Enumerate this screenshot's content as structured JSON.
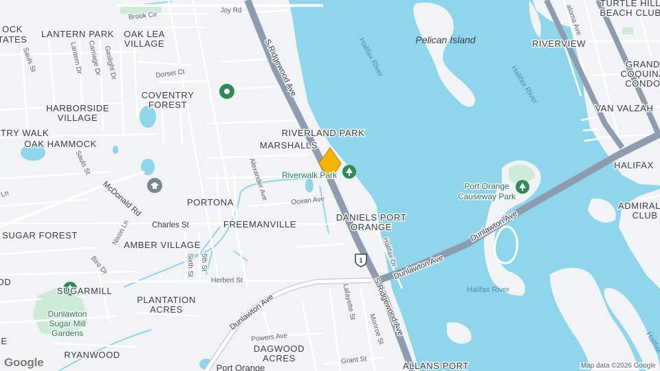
{
  "map": {
    "logo": "Google",
    "attribution": "Map data ©2026 Google",
    "colors": {
      "land": "#f1f3f4",
      "water": "#8fd6ec",
      "highway": "#8e9cb0",
      "road": "#ffffff",
      "park": "#cdebd6",
      "marker": "#f4b400"
    },
    "neighborhoods": {
      "lantern_park": "LANTERN PARK",
      "oak_lea": "OAK LEA",
      "village": "VILLAGE",
      "ock": "OCK",
      "tates": "TATES",
      "coventry": "COVENTRY",
      "forest": "FOREST",
      "harborside": "HARBORSIDE",
      "village2": "VILLAGE",
      "try_walk": "TRY WALK",
      "oak_hammock": "OAK HAMMOCK",
      "riverland_park": "RIVERLAND PARK",
      "marshalls": "MARSHALLS",
      "portona": "PORTONA",
      "freemanville": "FREEMANVILLE",
      "daniels_port": "DANIELS PORT",
      "orange": "ORANGE",
      "sugar_forest": "SUGAR FOREST",
      "amber_village": "AMBER VILLAGE",
      "od": "OD",
      "sugarmill": "SUGARMILL",
      "plantation": "PLANTATION",
      "acres": "ACRES",
      "e": "E",
      "ryanwood": "RYANWOOD",
      "dagwood": "DAGWOOD",
      "acres2": "ACRES",
      "allans_port": "ALLANS PORT",
      "riverview": "RIVERVIEW",
      "turtle_hill": "TURTLE HILL",
      "beach_club": "BEACH CLUB",
      "grand": "GRAND",
      "coquina": "COQUINA",
      "condo": "CONDO",
      "van_valzah": "VAN VALZAH",
      "halifax": "HALIFAX",
      "admiral": "ADMIRAL",
      "club": "CLUB",
      "ock2": "OCK"
    },
    "streets": {
      "joy_rd": "Joy Rd",
      "brook_cir": "Brook Cir",
      "dorset_ct": "Dorset Ct",
      "sauls_st": "Sauls St",
      "lantern_dr": "Lantern Dr",
      "carriage_dr": "Carriage Dr",
      "gaslight_dr": "Gaslight Dr",
      "sauls_st2": "Sauls St",
      "s_ridgewood_top": "S Ridgewood Ave",
      "s_ridgewood_bottom": "S Ridgewood Ave",
      "alexander_ave": "Alexander Ave",
      "ocean_ave": "Ocean Ave",
      "mcdonald_rd": "McDonald Rd",
      "charles_st": "Charles St",
      "nixon_ln": "Nixon Ln",
      "biro_dr": "Biro Dr",
      "sixth_st": "Sixth St",
      "fifth_st": "5th St",
      "herbert_st": "Herbert St",
      "dunlawton_ave_w": "Dunlawton Ave",
      "dunlawton_ave_mid": "Dunlawton Ave",
      "dunlawton_ave_e": "Dunlawton Ave",
      "halifax_dr": "Halifax Dr",
      "lafayette_st": "Lafayette St",
      "monroe_st": "Monroe St",
      "powers_ave": "Powers Ave",
      "grant_st": "Grant St",
      "paloma_ave": "aloma Ave",
      "ln": "Ln",
      "port_orange": "Port Orange",
      "route_1": "1"
    },
    "water": {
      "halifax_river_1": "Halifax River",
      "halifax_river_2": "Halifax River",
      "halifax_river_3": "Halifax River",
      "halifax_river_4": "Halifax"
    },
    "places": {
      "pelican_island": "Pelican Island",
      "riverwalk_park": "Riverwalk Park",
      "causeway_park_1": "Port Orange",
      "causeway_park_2": "Causeway Park",
      "dunlawton_1": "Dunlawton",
      "dunlawton_2": "Sugar Mill",
      "dunlawton_3": "Gardens"
    },
    "icons": [
      "park-pin-icon",
      "park-tree-icon",
      "school-pin-icon",
      "location-marker-icon"
    ]
  }
}
